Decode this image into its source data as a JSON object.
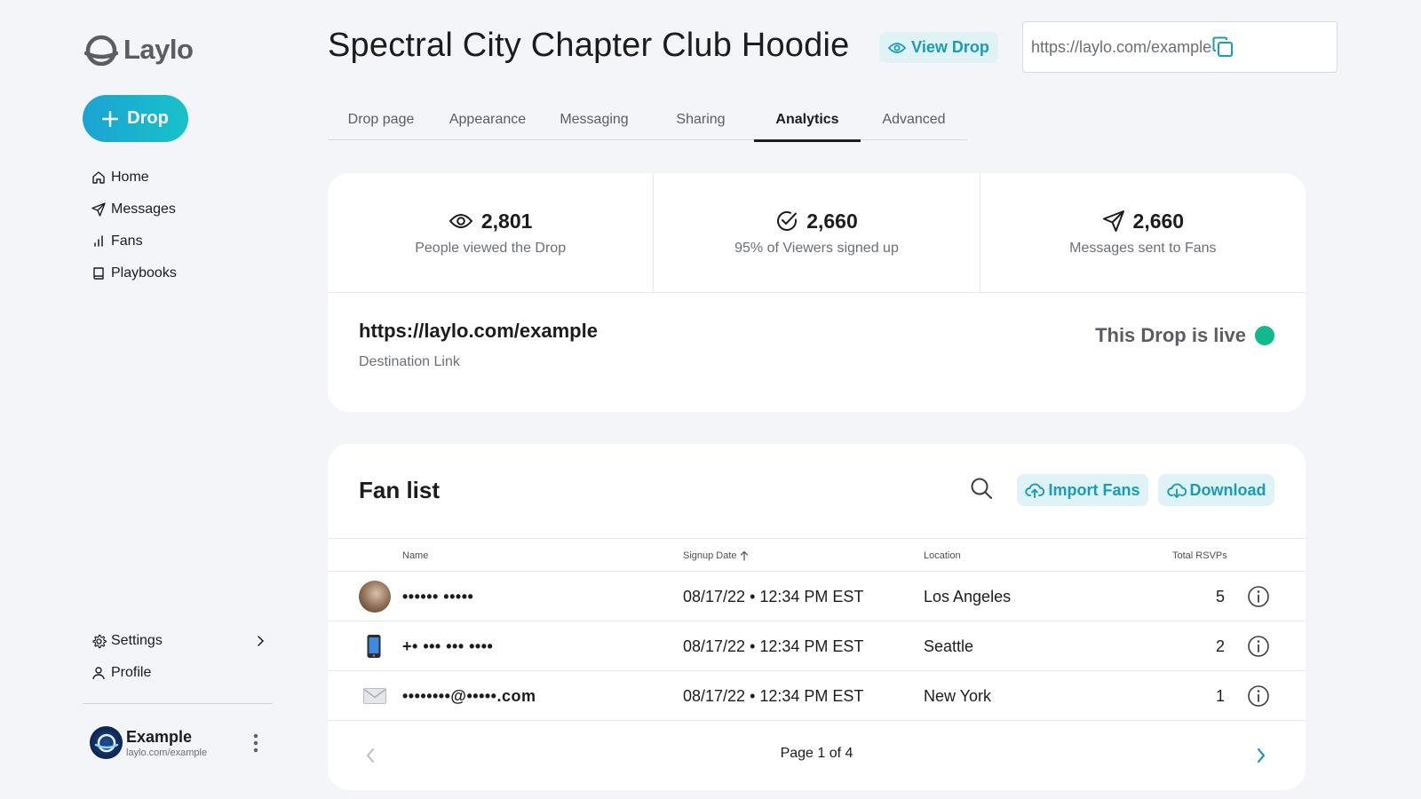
{
  "brand": {
    "name": "Laylo",
    "accent": "#1aa3d4",
    "accent_end": "#18c2c8",
    "pill_bg": "#dff3f6",
    "pill_text": "#1a9bb8",
    "live_color": "#12b98c"
  },
  "sidebar": {
    "create_label": "Drop",
    "items": [
      {
        "label": "Home",
        "icon": "home-icon"
      },
      {
        "label": "Messages",
        "icon": "send-icon"
      },
      {
        "label": "Fans",
        "icon": "bar-chart-icon"
      },
      {
        "label": "Playbooks",
        "icon": "book-icon"
      }
    ],
    "bottom_items": [
      {
        "label": "Settings",
        "icon": "gear-icon"
      },
      {
        "label": "Profile",
        "icon": "user-icon"
      }
    ],
    "account": {
      "name": "Example",
      "url": "laylo.com/example"
    }
  },
  "header": {
    "title": "Spectral City Chapter Club Hoodie",
    "view_drop_label": "View Drop",
    "share_url": "https://laylo.com/example"
  },
  "tabs": [
    {
      "label": "Drop page",
      "active": false
    },
    {
      "label": "Appearance",
      "active": false
    },
    {
      "label": "Messaging",
      "active": false
    },
    {
      "label": "Sharing",
      "active": false
    },
    {
      "label": "Analytics",
      "active": true
    },
    {
      "label": "Advanced",
      "active": false
    }
  ],
  "stats": [
    {
      "value": "2,801",
      "label": "People viewed the Drop",
      "icon": "eye-icon"
    },
    {
      "value": "2,660",
      "label": "95% of Viewers signed up",
      "icon": "check-circle-icon"
    },
    {
      "value": "2,660",
      "label": "Messages sent to Fans",
      "icon": "send-icon"
    }
  ],
  "destination": {
    "url": "https://laylo.com/example",
    "label": "Destination Link"
  },
  "live_status": "This Drop is live",
  "fan_list": {
    "title": "Fan list",
    "import_label": "Import Fans",
    "download_label": "Download",
    "columns": {
      "name": "Name",
      "signup_date": "Signup Date",
      "location": "Location",
      "total_rsvps": "Total RSVPs"
    },
    "rows": [
      {
        "name": "•••••• •••••",
        "type": "photo",
        "signup_date": "08/17/22 • 12:34 PM EST",
        "location": "Los Angeles",
        "rsvps": "5"
      },
      {
        "name": "+• ••• ••• ••••",
        "type": "phone",
        "signup_date": "08/17/22 • 12:34 PM EST",
        "location": "Seattle",
        "rsvps": "2"
      },
      {
        "name": "••••••••@•••••.com",
        "type": "email",
        "signup_date": "08/17/22 • 12:34 PM EST",
        "location": "New York",
        "rsvps": "1"
      }
    ],
    "pagination": "Page 1 of 4"
  }
}
